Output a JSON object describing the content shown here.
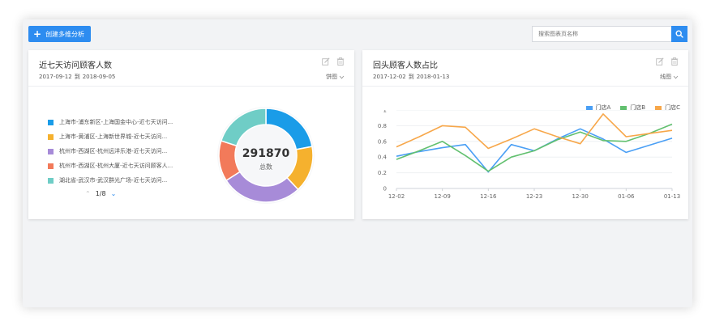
{
  "toolbar": {
    "create_label": "创建多维分析",
    "search_placeholder": "搜索图表页名称"
  },
  "card_left": {
    "title": "近七天访问顾客人数",
    "date_from": "2017-09-12",
    "date_sep": "到",
    "date_to": "2018-09-05",
    "chart_type": "饼图",
    "legend": [
      {
        "label": "上海市-浦东新区-上海国金中心-近七天访问...",
        "color": "#1a9ce8"
      },
      {
        "label": "上海市-黄浦区-上海新世界城-近七天访问...",
        "color": "#f5b12e"
      },
      {
        "label": "杭州市-西湖区-杭州远洋乐港-近七天访问...",
        "color": "#a78bd8"
      },
      {
        "label": "杭州市-西湖区-杭州大厦-近七天访问顾客人...",
        "color": "#f27a5a"
      },
      {
        "label": "湖北省-武汉市-武汉群光广场-近七天访问...",
        "color": "#6fcdc6"
      }
    ],
    "pager": "1/8",
    "total_value": "291870",
    "total_label": "总数"
  },
  "card_right": {
    "title": "回头顾客人数占比",
    "date_from": "2017-12-02",
    "date_sep": "到",
    "date_to": "2018-01-13",
    "chart_type": "线图"
  },
  "chart_data": [
    {
      "type": "pie",
      "labels": [
        "上海市-浦东新区-上海国金中心-近七天访问...",
        "上海市-黄浦区-上海新世界城-近七天访问...",
        "杭州市-西湖区-杭州远洋乐港-近七天访问...",
        "杭州市-西湖区-杭州大厦-近七天访问顾客人...",
        "湖北省-武汉市-武汉群光广场-近七天访问..."
      ],
      "values": [
        22,
        16,
        28,
        14,
        20
      ],
      "colors": [
        "#1a9ce8",
        "#f5b12e",
        "#a78bd8",
        "#f27a5a",
        "#6fcdc6"
      ],
      "center_value": "291870",
      "center_label": "总数"
    },
    {
      "type": "line",
      "categories": [
        "12-02",
        "12-09",
        "12-16",
        "12-23",
        "12-30",
        "01-06",
        "01-13"
      ],
      "x_tick_positions": [
        0,
        1,
        2,
        3,
        4,
        5,
        6
      ],
      "x": [
        0,
        0.5,
        1,
        1.5,
        2,
        2.5,
        3,
        3.5,
        4,
        4.5,
        5,
        5.5,
        6
      ],
      "yticks": [
        0,
        0.2,
        0.4,
        0.6,
        0.8,
        1
      ],
      "ylim": [
        0,
        1
      ],
      "grid": true,
      "legend_position": "top-right",
      "series": [
        {
          "name": "门店A",
          "color": "#4a9ff5",
          "values": [
            0.41,
            0.47,
            0.52,
            0.56,
            0.21,
            0.56,
            0.48,
            0.63,
            0.76,
            0.63,
            0.46,
            0.55,
            0.64
          ]
        },
        {
          "name": "门店B",
          "color": "#62c06f",
          "values": [
            0.37,
            0.48,
            0.6,
            0.42,
            0.22,
            0.4,
            0.48,
            0.62,
            0.72,
            0.61,
            0.6,
            0.7,
            0.82
          ]
        },
        {
          "name": "门店C",
          "color": "#f7a74a",
          "values": [
            0.53,
            0.66,
            0.8,
            0.78,
            0.51,
            0.63,
            0.76,
            0.66,
            0.57,
            0.95,
            0.66,
            0.7,
            0.74
          ]
        }
      ]
    }
  ]
}
